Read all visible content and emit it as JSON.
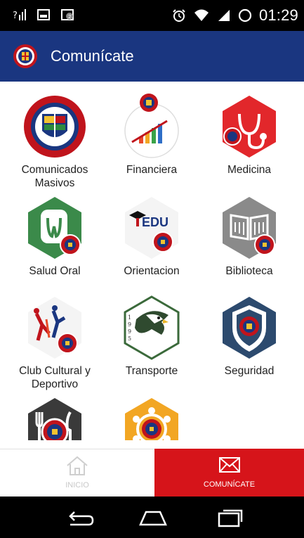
{
  "status_bar": {
    "time": "01:29",
    "icons": [
      "signal-unknown-icon",
      "image-icon",
      "notification-badge-icon",
      "alarm-icon",
      "wifi-icon",
      "cell-signal-icon",
      "battery-icon"
    ]
  },
  "app_bar": {
    "title": "Comunícate",
    "logo": "gimnasio-britanico-logo"
  },
  "tiles": [
    {
      "label": "Comunicados Masivos",
      "icon": "school-crest-icon"
    },
    {
      "label": "Financiera",
      "icon": "finance-chart-icon"
    },
    {
      "label": "Medicina",
      "icon": "stethoscope-icon"
    },
    {
      "label": "Salud Oral",
      "icon": "tooth-icon"
    },
    {
      "label": "Orientacion",
      "icon": "graduation-edu-icon",
      "icon_text": "EDU"
    },
    {
      "label": "Biblioteca",
      "icon": "book-icon"
    },
    {
      "label": "Club Cultural y Deportivo",
      "icon": "sports-figures-icon"
    },
    {
      "label": "Transporte",
      "icon": "eagle-icon"
    },
    {
      "label": "Seguridad",
      "icon": "shield-icon"
    },
    {
      "label": "",
      "icon": "dining-icon"
    },
    {
      "label": "",
      "icon": "community-icon"
    }
  ],
  "bottom_nav": {
    "inicio_label": "INICIO",
    "comunicate_label": "COMUNÍCATE"
  },
  "colors": {
    "app_bar": "#1a3680",
    "active_tab": "#d6141a",
    "status_bar": "#000000"
  }
}
